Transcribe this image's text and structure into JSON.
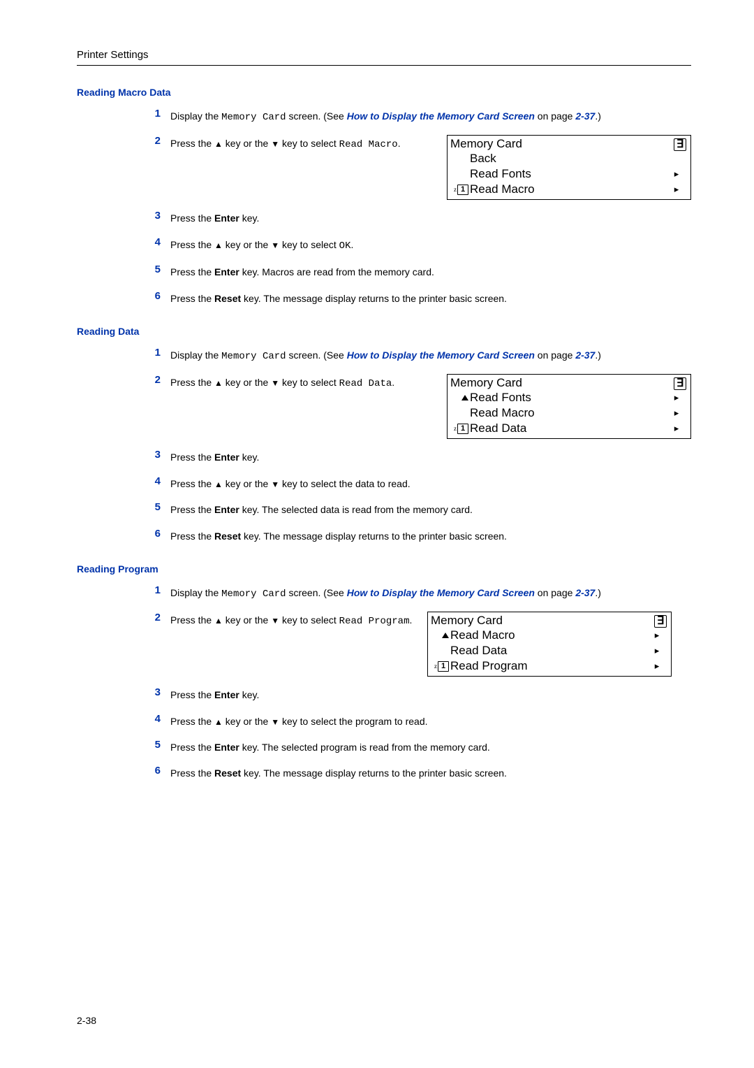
{
  "header": {
    "title": "Printer Settings"
  },
  "page_num": "2-38",
  "shared": {
    "display_title": "Memory Card",
    "display_corner_glyph": "∃",
    "arrow_glyph": "▸",
    "up_tri": "▲",
    "down_tri": "▼",
    "sel_z": "z",
    "sel_box": "1"
  },
  "sections": [
    {
      "heading": "Reading Macro Data",
      "display": {
        "scroll_hint": "none",
        "items": [
          {
            "label": "Back",
            "arrow": false,
            "selected": false
          },
          {
            "label": "Read Fonts",
            "arrow": true,
            "selected": false
          },
          {
            "label": "Read Macro",
            "arrow": true,
            "selected": true
          }
        ]
      },
      "steps": [
        {
          "n": "1",
          "parts": [
            "Display the ",
            {
              "mono": "Memory Card"
            },
            " screen. (See ",
            {
              "link": "How to Display the Memory Card Screen"
            },
            " on page ",
            {
              "pageref": "2-37"
            },
            ".)"
          ]
        },
        {
          "n": "2",
          "with_display": true,
          "parts": [
            "Press the ",
            {
              "tri": "▲"
            },
            " key or the ",
            {
              "tri": "▼"
            },
            " key to select ",
            {
              "mono": "Read Macro"
            },
            "."
          ]
        },
        {
          "n": "3",
          "parts": [
            "Press the ",
            {
              "bold": "Enter"
            },
            " key."
          ]
        },
        {
          "n": "4",
          "parts": [
            "Press the ",
            {
              "tri": "▲"
            },
            " key or the ",
            {
              "tri": "▼"
            },
            " key to select ",
            {
              "mono": "OK"
            },
            "."
          ]
        },
        {
          "n": "5",
          "parts": [
            "Press the ",
            {
              "bold": "Enter"
            },
            " key. Macros are read from the memory card."
          ]
        },
        {
          "n": "6",
          "parts": [
            "Press the ",
            {
              "bold": "Reset"
            },
            " key. The message display returns to the printer basic screen."
          ]
        }
      ]
    },
    {
      "heading": "Reading Data",
      "display": {
        "scroll_hint": "up",
        "items": [
          {
            "label": "Read Fonts",
            "arrow": true,
            "selected": false
          },
          {
            "label": "Read Macro",
            "arrow": true,
            "selected": false
          },
          {
            "label": "Read Data",
            "arrow": true,
            "selected": true
          }
        ]
      },
      "steps": [
        {
          "n": "1",
          "parts": [
            "Display the ",
            {
              "mono": "Memory Card"
            },
            " screen. (See ",
            {
              "link": "How to Display the Memory Card Screen"
            },
            " on page ",
            {
              "pageref": "2-37"
            },
            ".)"
          ]
        },
        {
          "n": "2",
          "with_display": true,
          "parts": [
            "Press the ",
            {
              "tri": "▲"
            },
            " key or the ",
            {
              "tri": "▼"
            },
            " key to select ",
            {
              "mono": "Read Data"
            },
            "."
          ]
        },
        {
          "n": "3",
          "parts": [
            "Press the ",
            {
              "bold": "Enter"
            },
            " key."
          ]
        },
        {
          "n": "4",
          "parts": [
            "Press the ",
            {
              "tri": "▲"
            },
            " key or the ",
            {
              "tri": "▼"
            },
            " key to select the data to read."
          ]
        },
        {
          "n": "5",
          "parts": [
            "Press the ",
            {
              "bold": "Enter"
            },
            " key. The selected data is read from the memory card."
          ]
        },
        {
          "n": "6",
          "parts": [
            "Press the ",
            {
              "bold": "Reset"
            },
            " key. The message display returns to the printer basic screen."
          ]
        }
      ]
    },
    {
      "heading": "Reading Program",
      "display": {
        "scroll_hint": "up",
        "items": [
          {
            "label": "Read Macro",
            "arrow": true,
            "selected": false
          },
          {
            "label": "Read Data",
            "arrow": true,
            "selected": false
          },
          {
            "label": "Read Program",
            "arrow": true,
            "selected": true
          }
        ]
      },
      "steps": [
        {
          "n": "1",
          "parts": [
            "Display the ",
            {
              "mono": "Memory Card"
            },
            " screen. (See ",
            {
              "link": "How to Display the Memory Card Screen"
            },
            " on page ",
            {
              "pageref": "2-37"
            },
            ".)"
          ]
        },
        {
          "n": "2",
          "with_display": true,
          "narrow": true,
          "parts": [
            "Press the ",
            {
              "tri": "▲"
            },
            " key or the ",
            {
              "tri": "▼"
            },
            " key to select ",
            {
              "mono": "Read Program"
            },
            "."
          ]
        },
        {
          "n": "3",
          "parts": [
            "Press the ",
            {
              "bold": "Enter"
            },
            " key."
          ]
        },
        {
          "n": "4",
          "parts": [
            "Press the ",
            {
              "tri": "▲"
            },
            " key or the ",
            {
              "tri": "▼"
            },
            " key to select the program to read."
          ]
        },
        {
          "n": "5",
          "parts": [
            "Press the ",
            {
              "bold": "Enter"
            },
            " key. The selected program is read from the memory card."
          ]
        },
        {
          "n": "6",
          "parts": [
            "Press the ",
            {
              "bold": "Reset"
            },
            " key. The message display returns to the printer basic screen."
          ]
        }
      ]
    }
  ]
}
